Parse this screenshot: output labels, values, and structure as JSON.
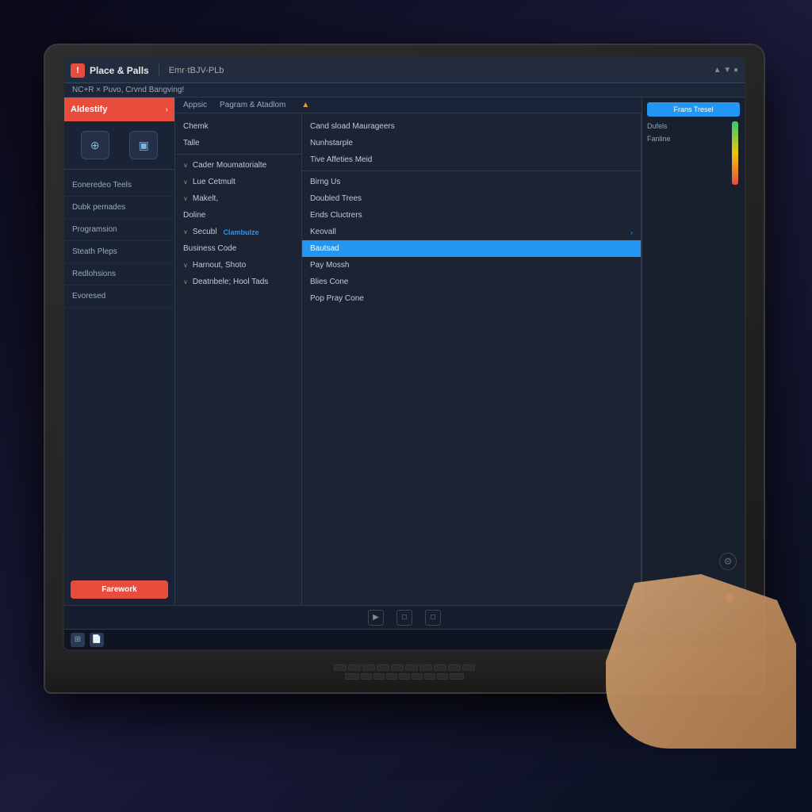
{
  "app": {
    "title": "Place & Palls",
    "subtitle": "Emr·tBJV-PLb",
    "alert_icon": "!",
    "top_nav_label": "NC+R × Puvo, Crvnd Bangving!"
  },
  "sidebar": {
    "header_label": "Aldestify",
    "chevron": ">",
    "nav_items": [
      {
        "label": "Eoneredeo Teels"
      },
      {
        "label": "Dubk pemades"
      },
      {
        "label": "Programsion"
      },
      {
        "label": "Steath Pleps"
      },
      {
        "label": "Redlohsions"
      },
      {
        "label": "Evoresed"
      }
    ],
    "footer_button": "Farework"
  },
  "sub_header": {
    "items": [
      "Appsic",
      "Pagram & Atadlom"
    ]
  },
  "col_left": {
    "items": [
      {
        "label": "Chemk",
        "prefix": ""
      },
      {
        "label": "Talle",
        "prefix": ""
      },
      {
        "label": "",
        "prefix": ""
      },
      {
        "label": "Cader Moumatorialte",
        "prefix": "∨"
      },
      {
        "label": "Lue Cetmult",
        "prefix": "∨"
      },
      {
        "label": "Makelt,",
        "prefix": "∨"
      },
      {
        "label": "Doline",
        "prefix": ""
      },
      {
        "label": "Secubl",
        "prefix": "∨"
      },
      {
        "label": "Business Code",
        "prefix": ""
      },
      {
        "label": "Harnout, Shoto",
        "prefix": "∨"
      },
      {
        "label": "Deatnbele; Hool Tads",
        "prefix": "∨"
      }
    ]
  },
  "col_mid": {
    "items": [
      {
        "label": "Cand sload Maurageers",
        "highlight": false
      },
      {
        "label": "Nunhstarple",
        "highlight": false
      },
      {
        "label": "Tive Affeties Meid",
        "highlight": false
      },
      {
        "label": "Birng Us",
        "highlight": false
      },
      {
        "label": "Doubled Trees",
        "highlight": false
      },
      {
        "label": "Ends Cluctrers",
        "highlight": false
      },
      {
        "label": "Keovall",
        "highlight": false
      },
      {
        "label": "Bautsad",
        "highlight": true
      },
      {
        "label": "Pay Mossh",
        "highlight": false
      },
      {
        "label": "Blies Cone",
        "highlight": false
      },
      {
        "label": "Pop Pray Cone",
        "highlight": false
      }
    ],
    "clambulze_label": "Clambulze"
  },
  "right_panel": {
    "button_label": "Frans Tresel",
    "items": [
      "Dufels",
      "Fanline"
    ]
  },
  "taskbar": {
    "icons": [
      "⊞",
      "📄"
    ]
  },
  "bottom": {
    "play_btn": "▶",
    "window_btns": [
      "□",
      "□"
    ]
  }
}
